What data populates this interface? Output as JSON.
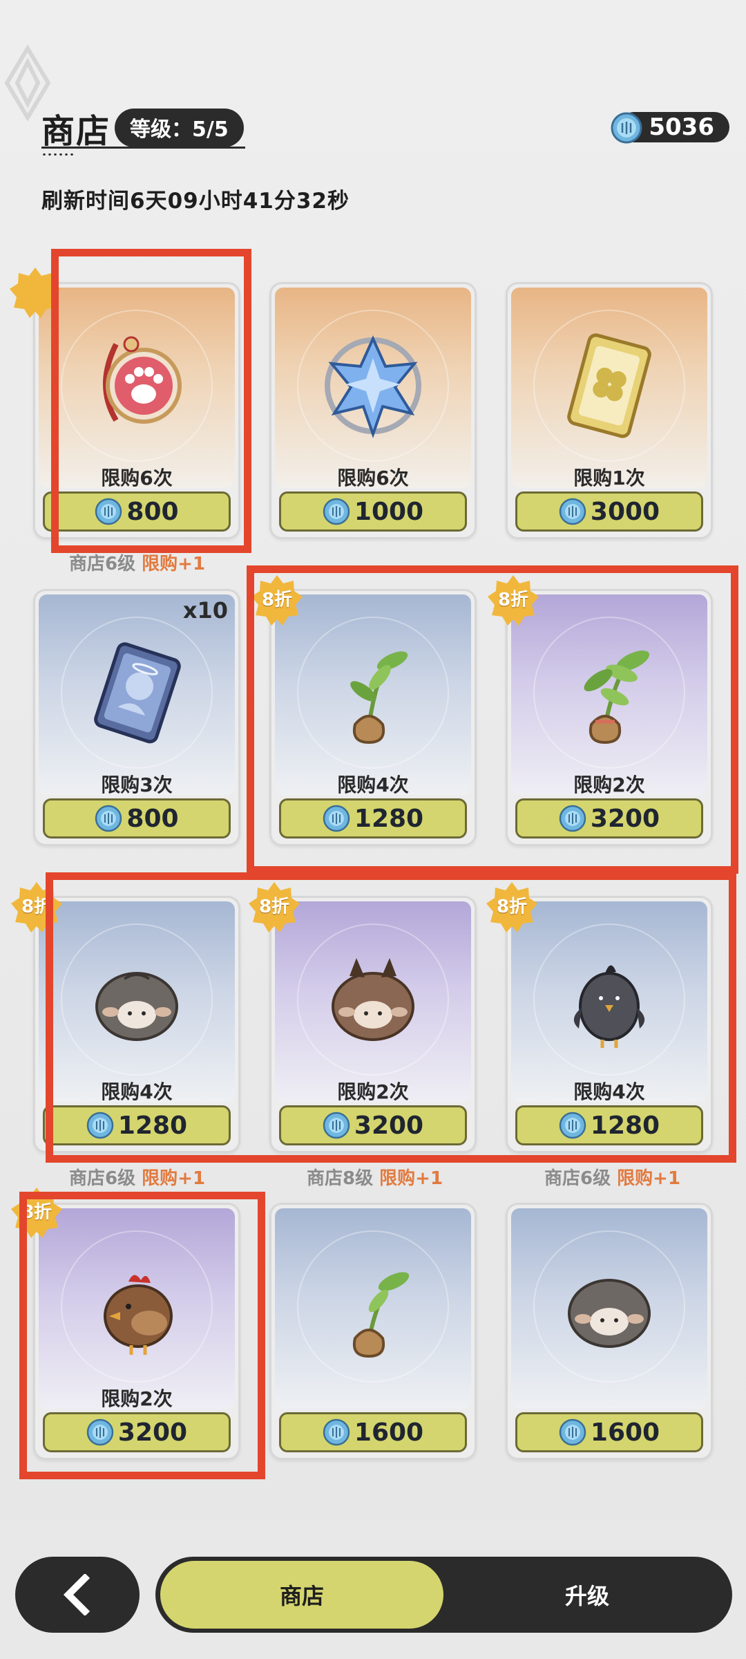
{
  "header": {
    "title": "商店",
    "level": "等级：5/5",
    "currency": "5036",
    "refresh": "刷新时间6天09小时41分32秒"
  },
  "items": [
    {
      "name": "paw-charm",
      "limit": "限购6次",
      "price": "800",
      "bg": "orange"
    },
    {
      "name": "crystal-star",
      "limit": "限购6次",
      "price": "1000",
      "bg": "orange"
    },
    {
      "name": "clover-ticket",
      "limit": "限购1次",
      "price": "3000",
      "bg": "orange"
    },
    {
      "name": "card-pack",
      "limit": "限购3次",
      "price": "800",
      "bg": "blue",
      "count": "x10"
    },
    {
      "name": "sapling",
      "limit": "限购4次",
      "price": "1280",
      "bg": "blue",
      "badge": "8折"
    },
    {
      "name": "sapling-large",
      "limit": "限购2次",
      "price": "3200",
      "bg": "purple",
      "badge": "8折"
    },
    {
      "name": "gray-sheep",
      "limit": "限购4次",
      "price": "1280",
      "bg": "blue",
      "badge": "8折"
    },
    {
      "name": "brown-sheep",
      "limit": "限购2次",
      "price": "3200",
      "bg": "purple",
      "badge": "8折"
    },
    {
      "name": "crow",
      "limit": "限购4次",
      "price": "1280",
      "bg": "blue",
      "badge": "8折"
    },
    {
      "name": "chicken",
      "limit": "限购2次",
      "price": "3200",
      "bg": "purple",
      "badge": "8折"
    },
    {
      "name": "sapling-small",
      "limit": "",
      "price": "1600",
      "bg": "blue"
    },
    {
      "name": "gray-sheep-small",
      "limit": "",
      "price": "1600",
      "bg": "blue"
    }
  ],
  "unlocks": {
    "row1_col1": {
      "prefix": "商店6级",
      "suffix": "限购+1"
    },
    "row3_col1": {
      "prefix": "商店6级",
      "suffix": "限购+1"
    },
    "row3_col2": {
      "prefix": "商店8级",
      "suffix": "限购+1"
    },
    "row3_col3": {
      "prefix": "商店6级",
      "suffix": "限购+1"
    }
  },
  "bottom_nav": {
    "shop": "商店",
    "upgrade": "升级"
  },
  "colors": {
    "accent": "#d4d56e",
    "dark": "#2b2b2b",
    "highlight": "#e3462c",
    "limit_plus": "#e27a3f"
  }
}
